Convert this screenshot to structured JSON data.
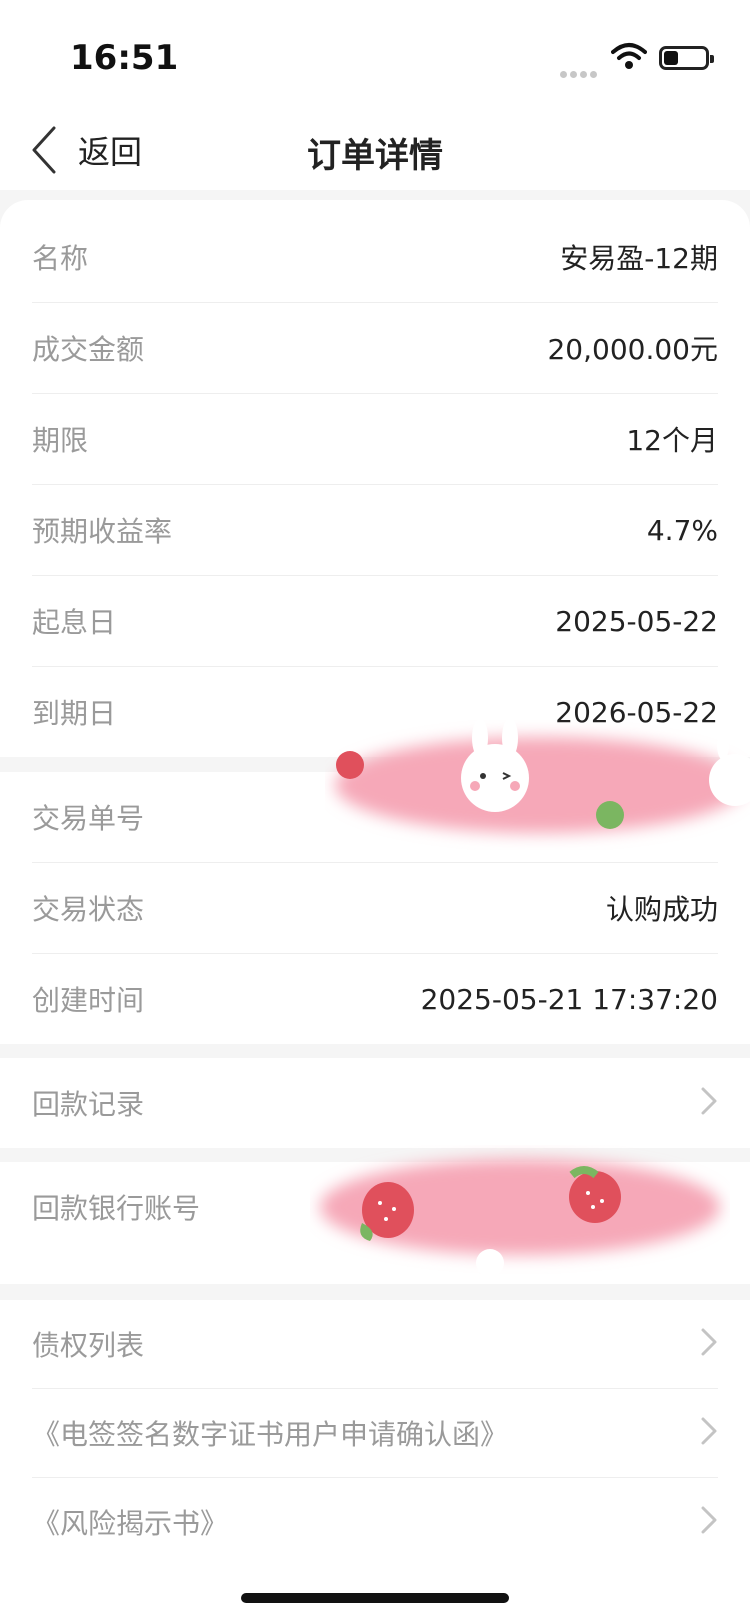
{
  "status_bar": {
    "time": "16:51"
  },
  "nav": {
    "back_label": "返回",
    "title": "订单详情"
  },
  "product_section": [
    {
      "label": "名称",
      "value": "安易盈-12期"
    },
    {
      "label": "成交金额",
      "value": "20,000.00元"
    },
    {
      "label": "期限",
      "value": "12个月"
    },
    {
      "label": "预期收益率",
      "value": "4.7%"
    },
    {
      "label": "起息日",
      "value": "2025-05-22"
    },
    {
      "label": "到期日",
      "value": "2026-05-22"
    }
  ],
  "transaction_section": [
    {
      "label": "交易单号",
      "value": ""
    },
    {
      "label": "交易状态",
      "value": "认购成功"
    },
    {
      "label": "创建时间",
      "value": "2025-05-21 17:37:20"
    }
  ],
  "repayment_record": {
    "label": "回款记录"
  },
  "bank_account": {
    "label": "回款银行账号"
  },
  "links": [
    {
      "label": "债权列表"
    },
    {
      "label": "《电签签名数字证书用户申请确认函》"
    },
    {
      "label": "《风险揭示书》"
    }
  ],
  "icons": {
    "back": "chevron-left-icon",
    "arrow": "chevron-right-icon",
    "wifi": "wifi-icon",
    "battery": "battery-icon"
  },
  "colors": {
    "label_gray": "#9a9a9a",
    "value_dark": "#222222",
    "redaction_pink": "#f6a8b8"
  }
}
